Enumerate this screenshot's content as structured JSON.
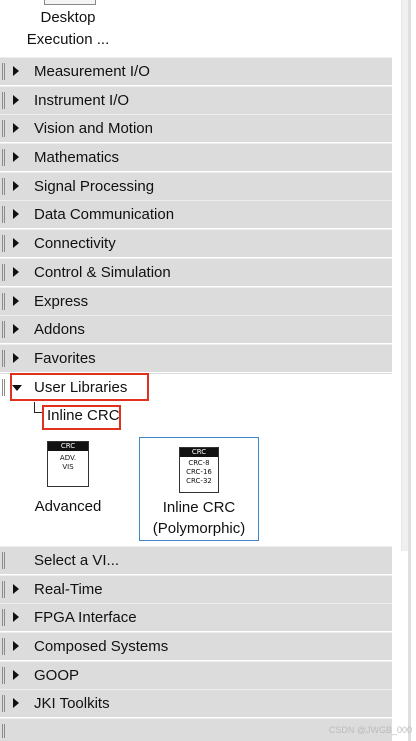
{
  "top_item": {
    "label_line1": "Desktop",
    "label_line2": "Execution ..."
  },
  "categories_top": [
    "Measurement I/O",
    "Instrument I/O",
    "Vision and Motion",
    "Mathematics",
    "Signal Processing",
    "Data Communication",
    "Connectivity",
    "Control & Simulation",
    "Express",
    "Addons",
    "Favorites"
  ],
  "user_libraries": {
    "label": "User Libraries",
    "subpalette": "Inline CRC",
    "vis": [
      {
        "label": "Advanced",
        "icon_header": "CRC",
        "icon_body": [
          "ADV.",
          "VIS"
        ]
      },
      {
        "label_line1": "Inline CRC",
        "label_line2": "(Polymorphic)",
        "icon_header": "CRC",
        "icon_body": [
          "CRC-8",
          "CRC-16",
          "CRC-32"
        ]
      }
    ]
  },
  "select_vi": "Select a VI...",
  "categories_bottom": [
    "Real-Time",
    "FPGA Interface",
    "Composed Systems",
    "GOOP",
    "JKI Toolkits"
  ],
  "watermark": "CSDN @JWGB_000",
  "colors": {
    "highlight": "#e0301e",
    "selection": "#3f86c9",
    "row_bg": "#dcdcdc"
  }
}
